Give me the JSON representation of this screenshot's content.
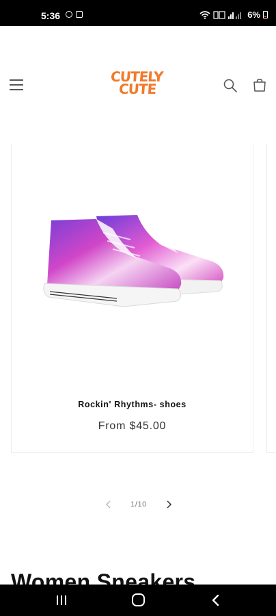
{
  "status_bar": {
    "time": "5:36",
    "battery": "6%",
    "icons": [
      "dollar-icon",
      "image-icon",
      "wifi-icon",
      "volte-icon",
      "signal-icon",
      "battery-icon"
    ]
  },
  "header": {
    "logo_line1": "CUTELY",
    "logo_line2": "CUTE",
    "icons": [
      "menu-icon",
      "search-icon",
      "cart-icon"
    ]
  },
  "product": {
    "title": "Rockin' Rhythms- shoes",
    "price": "From $45.00"
  },
  "slider": {
    "counter": "1/10"
  },
  "section": {
    "heading": "Women Sneakers"
  },
  "nav_bar": {
    "icons": [
      "recent-apps-icon",
      "home-icon",
      "back-icon"
    ]
  },
  "colors": {
    "brand": "#f07b2a",
    "text": "#121212",
    "border": "#ebebeb"
  }
}
